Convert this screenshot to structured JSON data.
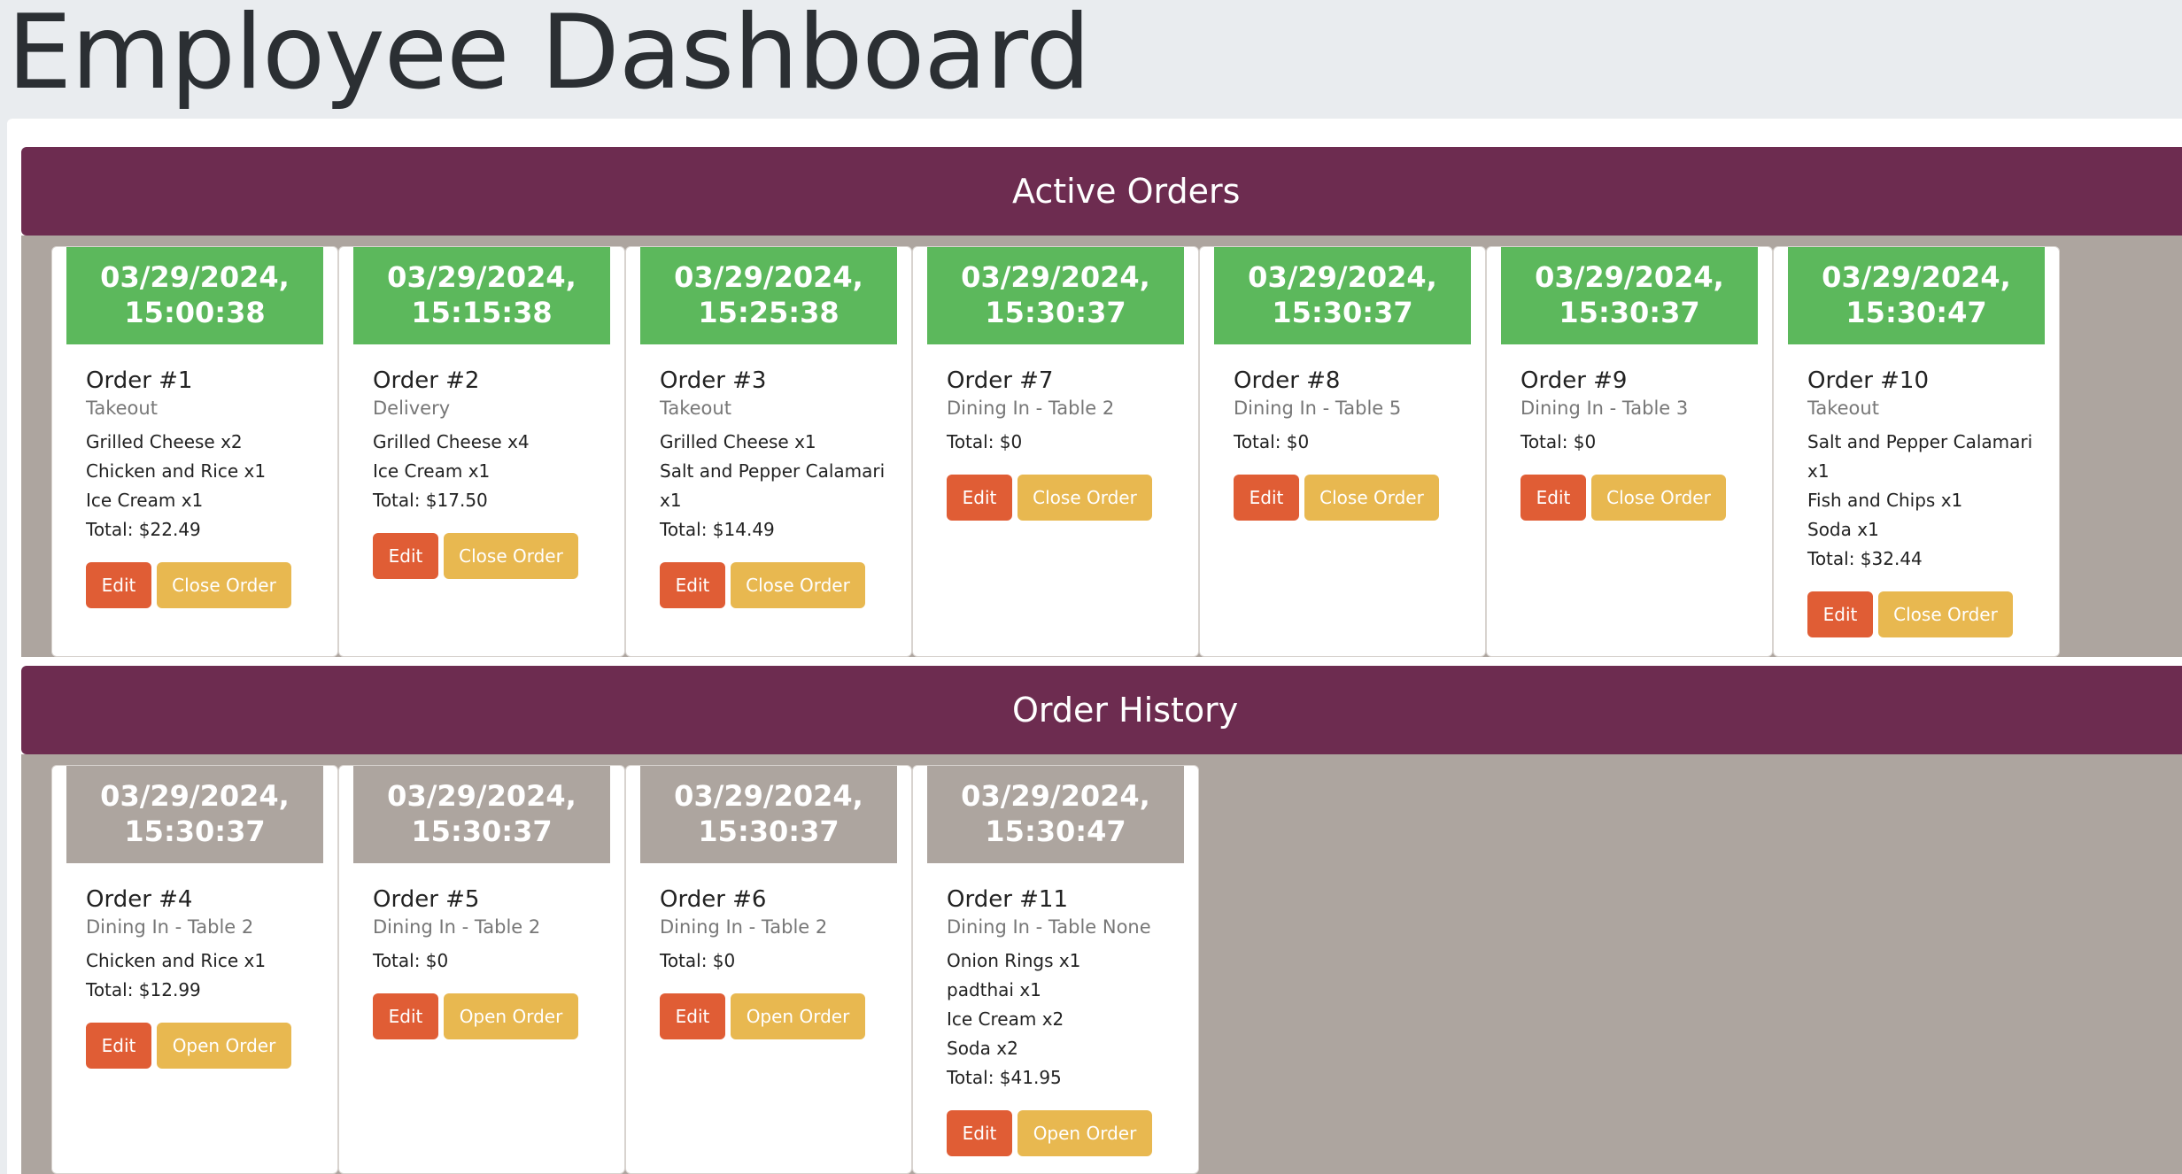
{
  "page_title": "Employee Dashboard",
  "active_section": {
    "title": "Active Orders",
    "orders": [
      {
        "date": "03/29/2024,",
        "time": "15:00:38",
        "order": "Order #1",
        "type": "Takeout",
        "items": [
          "Grilled Cheese x2",
          "Chicken and Rice x1",
          "Ice Cream x1"
        ],
        "total": "Total: $22.49",
        "edit_label": "Edit",
        "toggle_label": "Close Order"
      },
      {
        "date": "03/29/2024,",
        "time": "15:15:38",
        "order": "Order #2",
        "type": "Delivery",
        "items": [
          "Grilled Cheese x4",
          "Ice Cream x1"
        ],
        "total": "Total: $17.50",
        "edit_label": "Edit",
        "toggle_label": "Close Order"
      },
      {
        "date": "03/29/2024,",
        "time": "15:25:38",
        "order": "Order #3",
        "type": "Takeout",
        "items": [
          "Grilled Cheese x1",
          "Salt and Pepper Calamari",
          "x1"
        ],
        "total": "Total: $14.49",
        "edit_label": "Edit",
        "toggle_label": "Close Order"
      },
      {
        "date": "03/29/2024,",
        "time": "15:30:37",
        "order": "Order #7",
        "type": "Dining In - Table 2",
        "items": [],
        "total": "Total: $0",
        "edit_label": "Edit",
        "toggle_label": "Close Order"
      },
      {
        "date": "03/29/2024,",
        "time": "15:30:37",
        "order": "Order #8",
        "type": "Dining In - Table 5",
        "items": [],
        "total": "Total: $0",
        "edit_label": "Edit",
        "toggle_label": "Close Order"
      },
      {
        "date": "03/29/2024,",
        "time": "15:30:37",
        "order": "Order #9",
        "type": "Dining In - Table 3",
        "items": [],
        "total": "Total: $0",
        "edit_label": "Edit",
        "toggle_label": "Close Order"
      },
      {
        "date": "03/29/2024,",
        "time": "15:30:47",
        "order": "Order #10",
        "type": "Takeout",
        "items": [
          "Salt and Pepper Calamari",
          "x1",
          "Fish and Chips x1",
          "Soda x1"
        ],
        "total": "Total: $32.44",
        "edit_label": "Edit",
        "toggle_label": "Close Order"
      }
    ]
  },
  "history_section": {
    "title": "Order History",
    "orders": [
      {
        "date": "03/29/2024,",
        "time": "15:30:37",
        "order": "Order #4",
        "type": "Dining In - Table 2",
        "items": [
          "Chicken and Rice x1"
        ],
        "total": "Total: $12.99",
        "edit_label": "Edit",
        "toggle_label": "Open Order"
      },
      {
        "date": "03/29/2024,",
        "time": "15:30:37",
        "order": "Order #5",
        "type": "Dining In - Table 2",
        "items": [],
        "total": "Total: $0",
        "edit_label": "Edit",
        "toggle_label": "Open Order"
      },
      {
        "date": "03/29/2024,",
        "time": "15:30:37",
        "order": "Order #6",
        "type": "Dining In - Table 2",
        "items": [],
        "total": "Total: $0",
        "edit_label": "Edit",
        "toggle_label": "Open Order"
      },
      {
        "date": "03/29/2024,",
        "time": "15:30:47",
        "order": "Order #11",
        "type": "Dining In - Table None",
        "items": [
          "Onion Rings x1",
          "padthai x1",
          "Ice Cream x2",
          "Soda x2"
        ],
        "total": "Total: $41.95",
        "edit_label": "Edit",
        "toggle_label": "Open Order"
      }
    ]
  },
  "colors": {
    "active_header": "#5cb85c",
    "closed_header": "#ada59f",
    "section_bar": "#6d2c50",
    "edit_button": "#e05d35",
    "toggle_button": "#e8b850"
  }
}
